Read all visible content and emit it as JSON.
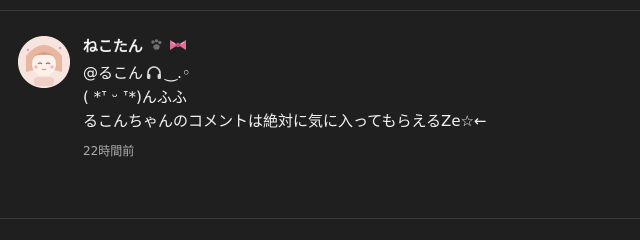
{
  "comment": {
    "author": "ねこたん",
    "author_emoji": [
      "paw-icon",
      "ribbon-icon"
    ],
    "avatar": "anime-girl-avatar",
    "reply_mention_prefix": "@るこん",
    "reply_mention_suffix": "‿.◦",
    "line2": "( *ᐪ ᵕ ᐪ*)んふふ",
    "line3": "るこんちゃんのコメントは絶対に気に入ってもらえるZe☆←",
    "timestamp": "22時間前"
  },
  "colors": {
    "background": "#1f1f1f",
    "text": "#f1f1f1",
    "muted": "#aaaaaa",
    "divider": "#3a3a3a",
    "ribbon": "#e56b9a"
  }
}
